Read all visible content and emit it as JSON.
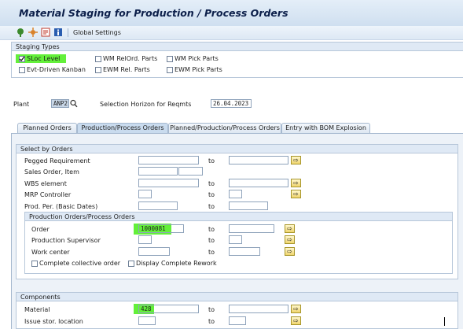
{
  "title": "Material Staging for Production / Process Orders",
  "toolbar": {
    "icons": [
      "execute-icon",
      "settings-icon",
      "variant-icon",
      "info-icon"
    ],
    "global_settings": "Global Settings"
  },
  "staging_types": {
    "header": "Staging Types",
    "options": [
      {
        "label": "SLoc Level",
        "checked": true
      },
      {
        "label": "WM RelOrd. Parts",
        "checked": false
      },
      {
        "label": "WM Pick Parts",
        "checked": false
      },
      {
        "label": "Evt-Driven Kanban",
        "checked": false
      },
      {
        "label": "EWM Rel. Parts",
        "checked": false
      },
      {
        "label": "EWM Pick Parts",
        "checked": false
      }
    ]
  },
  "plant": {
    "label": "Plant",
    "value": "ANP2"
  },
  "horizon": {
    "label": "Selection Horizon for Reqmts",
    "value": "26.04.2023"
  },
  "tabs": [
    {
      "label": "Planned Orders",
      "active": false
    },
    {
      "label": "Production/Process Orders",
      "active": true
    },
    {
      "label": "Planned/Production/Process Orders",
      "active": false
    },
    {
      "label": "Entry with BOM Explosion",
      "active": false
    }
  ],
  "select_by_orders": {
    "header": "Select by Orders",
    "to": "to",
    "rows": {
      "pegged": "Pegged Requirement",
      "sales_order": "Sales Order, Item",
      "wbs": "WBS element",
      "mrp": "MRP Controller",
      "prod_per": "Prod. Per. (Basic Dates)"
    },
    "subgroup": {
      "header": "Production Orders/Process Orders",
      "order": {
        "label": "Order",
        "value": "1000081"
      },
      "supervisor": "Production Supervisor",
      "work_center": "Work center",
      "complete_collective": "Complete collective order",
      "display_rework": "Display Complete Rework"
    }
  },
  "components": {
    "header": "Components",
    "material": {
      "label": "Material",
      "value": "428"
    },
    "issue_sloc": "Issue stor. location",
    "to": "to"
  },
  "arrow_glyph": "⇨"
}
